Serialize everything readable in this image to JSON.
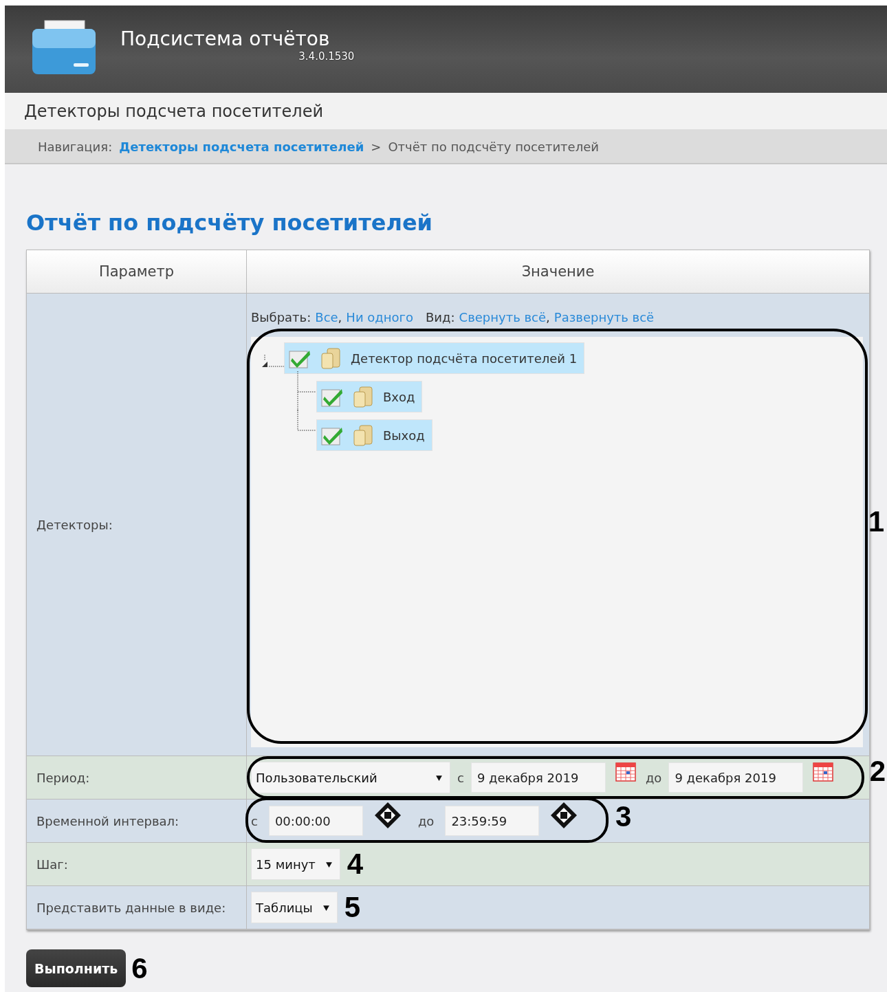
{
  "header": {
    "title": "Подсистема отчётов",
    "version": "3.4.0.1530"
  },
  "section_title": "Детекторы подсчета посетителей",
  "breadcrumb": {
    "label": "Навигация:",
    "link": "Детекторы подсчета посетителей",
    "separator": ">",
    "current": "Отчёт по подсчёту посетителей"
  },
  "page_title": "Отчёт по подсчёту посетителей",
  "table": {
    "columns": [
      "Параметр",
      "Значение"
    ],
    "rows": [
      {
        "kind": "tree",
        "label": "Детекторы:",
        "callout": "1",
        "select_label": "Выбрать:",
        "select_links": [
          "Все",
          "Ни одного"
        ],
        "view_label": "Вид:",
        "view_links": [
          "Свернуть всё",
          "Развернуть всё"
        ],
        "separator": ",",
        "tree": [
          {
            "label": "Детектор подсчёта посетителей 1",
            "checked": true,
            "selected": true,
            "expanded": true,
            "children": [
              {
                "label": "Вход",
                "checked": true,
                "selected": true
              },
              {
                "label": "Выход",
                "checked": true,
                "selected": true
              }
            ]
          }
        ]
      },
      {
        "kind": "period",
        "label": "Период:",
        "callout": "2",
        "preset": "Пользовательский",
        "from_label": "с",
        "from": "9 декабря 2019",
        "to_label": "до",
        "to": "9 декабря 2019"
      },
      {
        "kind": "time",
        "label": "Временной интервал:",
        "callout": "3",
        "from_label": "с",
        "from": "00:00:00",
        "to_label": "до",
        "to": "23:59:59"
      },
      {
        "kind": "select",
        "label": "Шаг:",
        "callout": "4",
        "value": "15 минут"
      },
      {
        "kind": "select",
        "label": "Представить данные в виде:",
        "callout": "5",
        "value": "Таблицы"
      }
    ]
  },
  "run_button": {
    "label": "Выполнить",
    "callout": "6"
  }
}
